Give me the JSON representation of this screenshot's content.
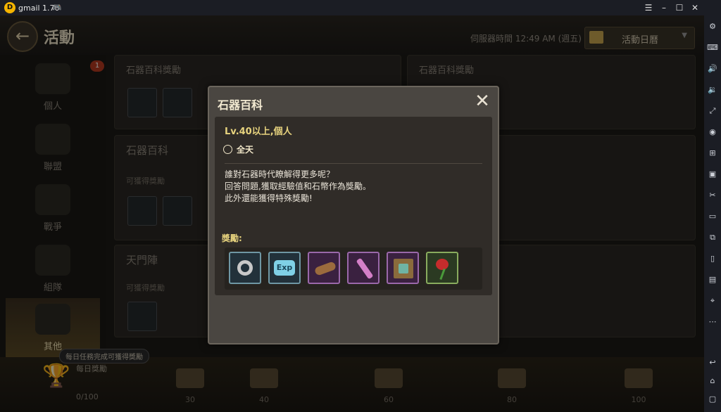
{
  "window": {
    "app_title": "gmail 1.70",
    "controls": [
      "menu-icon",
      "minimize-icon",
      "maximize-icon",
      "close-icon"
    ]
  },
  "game": {
    "page_title": "活動",
    "server_time": "伺服器時間 12:49 AM (週五)",
    "calendar_button": "活動日曆",
    "nav": [
      {
        "label": "個人",
        "badge": "1"
      },
      {
        "label": "聯盟",
        "badge": ""
      },
      {
        "label": "戰爭",
        "badge": ""
      },
      {
        "label": "組隊",
        "badge": ""
      },
      {
        "label": "其他",
        "badge": ""
      }
    ],
    "panels": [
      {
        "title": "石器百科獎勵"
      },
      {
        "title": "石器百科獎勵"
      },
      {
        "title": "石器百科",
        "sub": "可獲得獎勵"
      },
      {
        "title": "天門陣",
        "sub": "可獲得獎勵"
      }
    ],
    "bottom": {
      "tip": "每日任務完成可獲得獎勵",
      "daily_label": "每日獎勵",
      "progress": "0/100",
      "milestones": [
        "30",
        "40",
        "60",
        "80",
        "100"
      ]
    }
  },
  "dialog": {
    "title": "石器百科",
    "level": "Lv.40以上,個人",
    "time": "全天",
    "description": [
      "誰對石器時代瞭解得更多呢？",
      "回答問題,獲取經驗值和石幣作為獎勵。",
      "此外還能獲得特殊獎勵!"
    ],
    "reward_label": "獎勵:",
    "rewards": [
      {
        "icon": "nut-icon",
        "rarity": "teal"
      },
      {
        "icon": "exp-icon",
        "text": "Exp",
        "rarity": "teal"
      },
      {
        "icon": "log-icon",
        "rarity": "purple"
      },
      {
        "icon": "scroll-icon",
        "rarity": "purple"
      },
      {
        "icon": "map-icon",
        "rarity": "purple"
      },
      {
        "icon": "rose-icon",
        "rarity": "green"
      }
    ]
  },
  "colors": {
    "accent_gold": "#e7d37e",
    "rarity_teal": "#6f97a4",
    "rarity_purple": "#9a68aa",
    "rarity_green": "#89ac5e"
  }
}
